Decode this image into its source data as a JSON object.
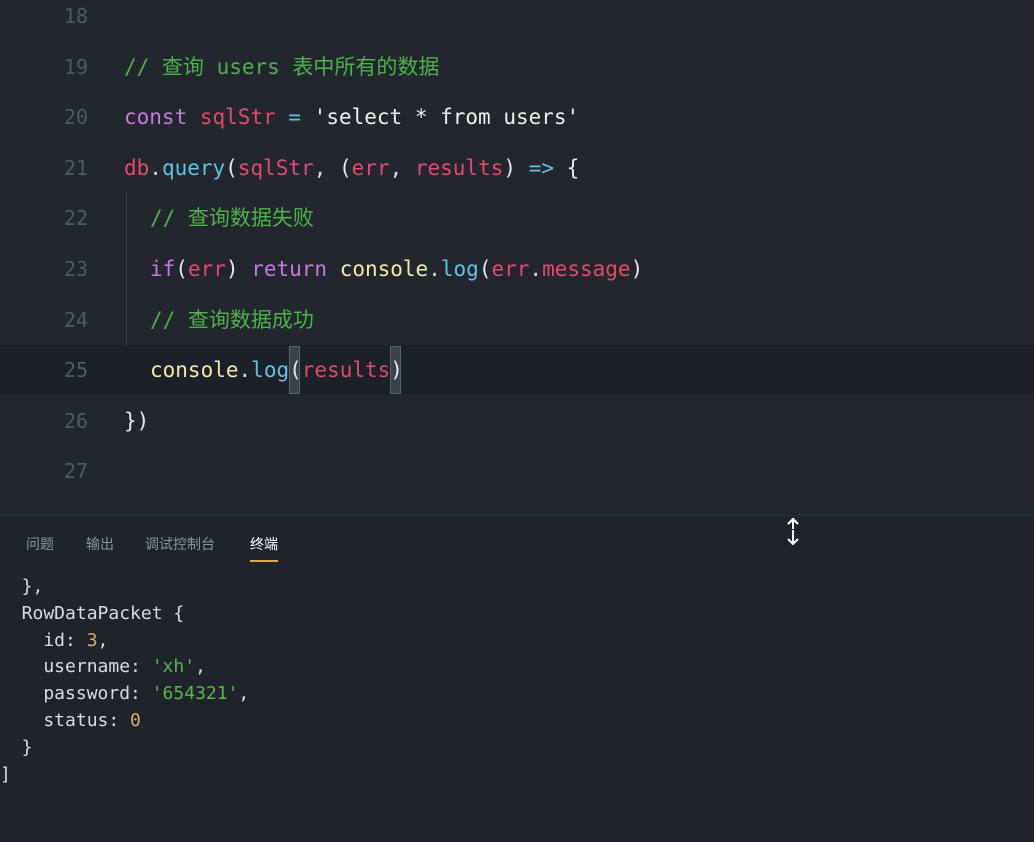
{
  "editor": {
    "lines": [
      {
        "num": "18"
      },
      {
        "num": "19",
        "comment": "// 查询 users 表中所有的数据"
      },
      {
        "num": "20",
        "kw": "const",
        "var": "sqlStr",
        "eq": " = ",
        "str": "'select * from users'"
      },
      {
        "num": "21",
        "obj": "db",
        "dot": ".",
        "fn": "query",
        "p1": "(",
        "arg1": "sqlStr",
        "comma": ", ",
        "p2": "(",
        "arg2": "err",
        "comma2": ", ",
        "arg3": "results",
        "p3": ")",
        "arrow": " => ",
        "brace": "{"
      },
      {
        "num": "22",
        "comment": "// 查询数据失败"
      },
      {
        "num": "23",
        "kw": "if",
        "p1": "(",
        "arg": "err",
        "p2": ")",
        "kw2": " return ",
        "obj": "console",
        "dot": ".",
        "fn": "log",
        "p3": "(",
        "arg2": "err",
        "dot2": ".",
        "prop": "message",
        "p4": ")"
      },
      {
        "num": "24",
        "comment": "// 查询数据成功"
      },
      {
        "num": "25",
        "obj": "console",
        "dot": ".",
        "fn": "log",
        "p1": "(",
        "arg": "results",
        "p2": ")"
      },
      {
        "num": "26",
        "close": "})"
      },
      {
        "num": "27"
      }
    ]
  },
  "panel": {
    "tabs": [
      "问题",
      "输出",
      "调试控制台",
      "终端"
    ],
    "active_tab": "终端"
  },
  "terminal": {
    "l1": "  },",
    "l2": "  RowDataPacket {",
    "l3_key": "    id: ",
    "l3_val": "3",
    "l3_end": ",",
    "l4_key": "    username: ",
    "l4_val": "'xh'",
    "l4_end": ",",
    "l5_key": "    password: ",
    "l5_val": "'654321'",
    "l5_end": ",",
    "l6_key": "    status: ",
    "l6_val": "0",
    "l7": "  }",
    "l8": "]"
  },
  "colors": {
    "editor_bg": "#22272e",
    "comment": "#4eb04a",
    "keyword": "#c678dd",
    "variable": "#e5486a",
    "function": "#5fc3e4",
    "tab_underline": "#e0a44d"
  }
}
